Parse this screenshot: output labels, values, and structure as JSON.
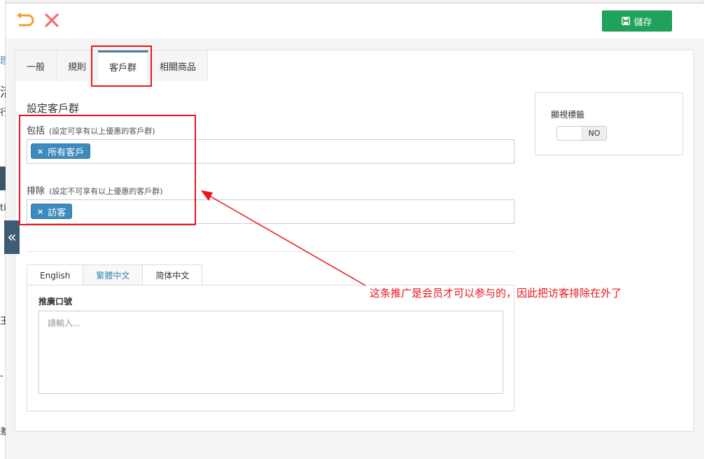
{
  "background": {
    "fragments": [
      "理",
      "活",
      "行",
      "ti",
      "王",
      "-",
      "差"
    ]
  },
  "toolbar": {
    "undo_icon": "undo-icon",
    "close_icon": "close-icon",
    "save_label": "儲存",
    "save_icon": "save-icon",
    "colors": {
      "save": "#1fa35a",
      "undo": "#f0a030",
      "close": "#f07070"
    }
  },
  "tabs": [
    {
      "label": "一般",
      "active": false
    },
    {
      "label": "規則",
      "active": false
    },
    {
      "label": "客戶群",
      "active": true
    },
    {
      "label": "相關商品",
      "active": false
    }
  ],
  "section_title": "設定客戶群",
  "include": {
    "label": "包括",
    "hint": "(設定可享有以上優惠的客戶群)",
    "tags": [
      "所有客戶"
    ]
  },
  "exclude": {
    "label": "排除",
    "hint": "(設定不可享有以上優惠的客戶群)",
    "tags": [
      "訪客"
    ]
  },
  "lang_tabs": [
    {
      "label": "English",
      "active": false
    },
    {
      "label": "繁體中文",
      "active": true
    },
    {
      "label": "简体中文",
      "active": false
    }
  ],
  "slogan": {
    "label": "推廣口號",
    "placeholder": "請輸入...",
    "value": ""
  },
  "display_card": {
    "label": "顯視標籤",
    "toggle_state": "NO"
  },
  "annotation": {
    "text": "这条推广是会员才可以参与的，因此把访客排除在外了",
    "color": "#e8161a"
  },
  "collapse_icon": "double-chevron-left-icon"
}
